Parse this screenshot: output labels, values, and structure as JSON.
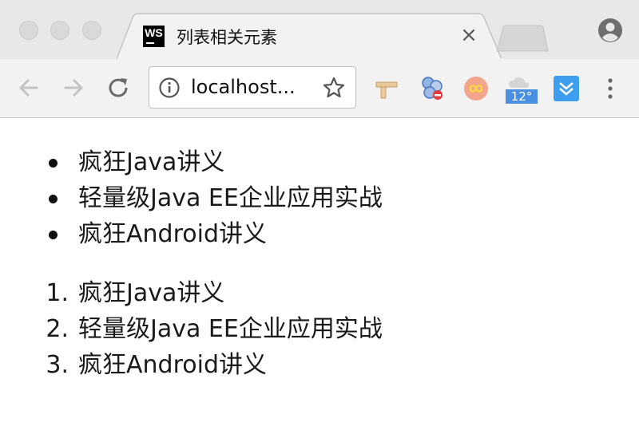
{
  "browser": {
    "tab": {
      "title": "列表相关元素",
      "favicon_text": "WS",
      "close_glyph": "×"
    },
    "address_bar": {
      "url": "localhost..."
    },
    "extensions": {
      "weather_badge": "12°"
    },
    "icons": [
      "back-arrow-icon",
      "forward-arrow-icon",
      "reload-icon",
      "info-icon",
      "star-icon",
      "profile-icon",
      "menu-kebab-icon"
    ]
  },
  "page": {
    "unordered_list": [
      "疯狂Java讲义",
      "轻量级Java EE企业应用实战",
      "疯狂Android讲义"
    ],
    "ordered_list": [
      {
        "marker": "1.",
        "text": "疯狂Java讲义"
      },
      {
        "marker": "2.",
        "text": "轻量级Java EE企业应用实战"
      },
      {
        "marker": "3.",
        "text": "疯狂Android讲义"
      }
    ]
  },
  "colors": {
    "tabbar": "#e8e8e8",
    "toolbar": "#f2f2f2",
    "text": "#1a1a1a",
    "weather_badge": "#4a8fe0"
  }
}
